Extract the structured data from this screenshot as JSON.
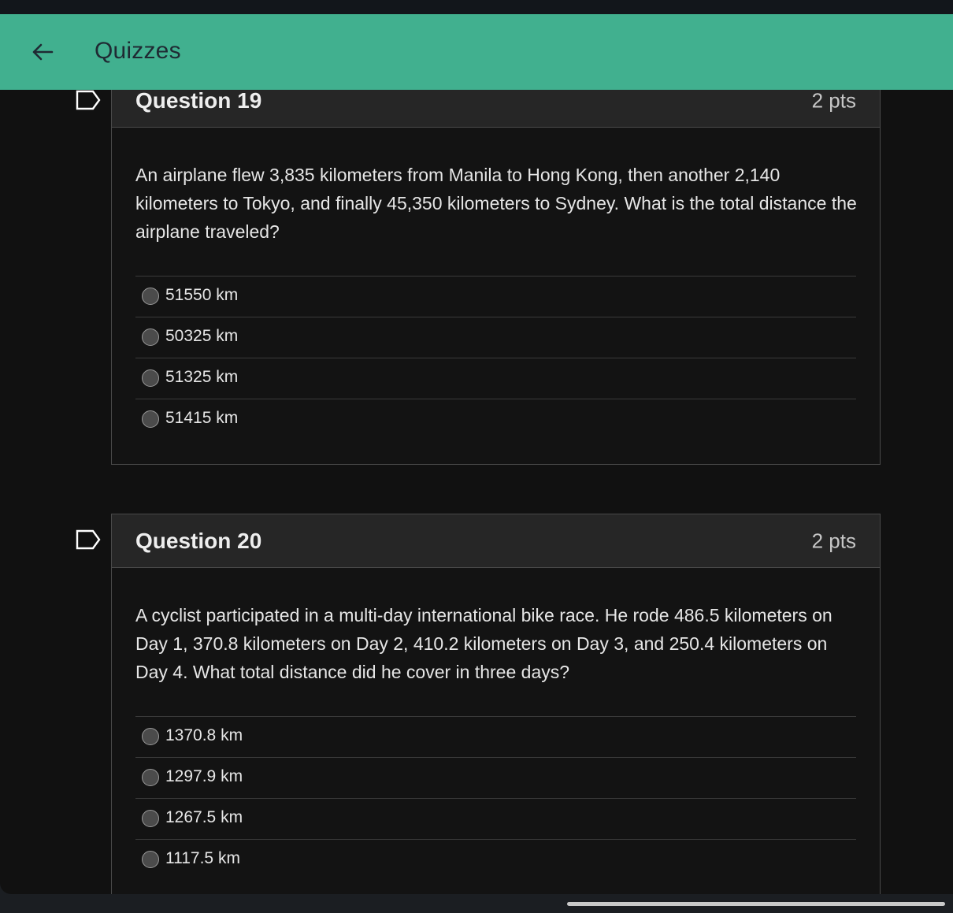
{
  "header": {
    "title": "Quizzes"
  },
  "questions": [
    {
      "title": "Question 19",
      "points": "2 pts",
      "text": "An airplane flew 3,835 kilometers from Manila to Hong Kong, then another 2,140 kilometers to Tokyo, and finally 45,350 kilometers to Sydney. What is the total distance the airplane traveled?",
      "answers": [
        "51550 km",
        "50325 km",
        "51325 km",
        "51415 km"
      ]
    },
    {
      "title": "Question 20",
      "points": "2 pts",
      "text": "A cyclist participated in a multi-day international bike race. He rode 486.5 kilometers on Day 1, 370.8 kilometers on Day 2, 410.2 kilometers on Day 3, and 250.4 kilometers on Day 4. What total distance did he cover in three days?",
      "answers": [
        "1370.8 km",
        "1297.9 km",
        "1267.5 km",
        "1117.5 km"
      ]
    }
  ],
  "colors": {
    "accent": "#41b08f",
    "background": "#111111",
    "card_header": "#262626"
  }
}
